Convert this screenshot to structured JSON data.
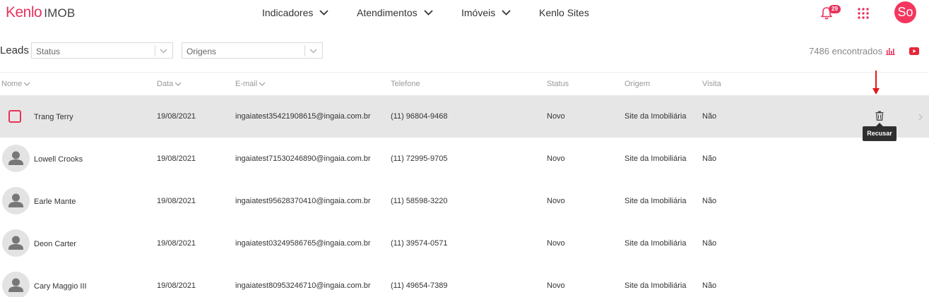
{
  "brand": {
    "logo_main": "Kenlo",
    "logo_sub": "IMOB",
    "accent": "#e8325d"
  },
  "nav": [
    {
      "label": "Indicadores",
      "dropdown": true
    },
    {
      "label": "Atendimentos",
      "dropdown": true
    },
    {
      "label": "Imóveis",
      "dropdown": true
    },
    {
      "label": "Kenlo Sites",
      "dropdown": false
    }
  ],
  "notifications": {
    "count": "29",
    "icon": "bell-icon"
  },
  "user": {
    "initials": "So"
  },
  "page": {
    "title": "Leads"
  },
  "filters": {
    "status": {
      "placeholder": "Status"
    },
    "origens": {
      "placeholder": "Origens"
    }
  },
  "results": {
    "found": "7486 encontrados"
  },
  "table": {
    "columns": [
      "Nome",
      "Data",
      "E-mail",
      "Telefone",
      "Status",
      "Origem",
      "Visita"
    ],
    "rows": [
      {
        "name": "Trang Terry",
        "date": "19/08/2021",
        "email": "ingaiatest35421908615@ingaia.com.br",
        "phone": "(11) 96804-9468",
        "status": "Novo",
        "origin": "Site da Imobiliária",
        "visit": "Não"
      },
      {
        "name": "Lowell Crooks",
        "date": "19/08/2021",
        "email": "ingaiatest71530246890@ingaia.com.br",
        "phone": "(11) 72995-9705",
        "status": "Novo",
        "origin": "Site da Imobiliária",
        "visit": "Não"
      },
      {
        "name": "Earle Mante",
        "date": "19/08/2021",
        "email": "ingaiatest95628370410@ingaia.com.br",
        "phone": "(11) 58598-3220",
        "status": "Novo",
        "origin": "Site da Imobiliária",
        "visit": "Não"
      },
      {
        "name": "Deon Carter",
        "date": "19/08/2021",
        "email": "ingaiatest03249586765@ingaia.com.br",
        "phone": "(11) 39574-0571",
        "status": "Novo",
        "origin": "Site da Imobiliária",
        "visit": "Não"
      },
      {
        "name": "Cary Maggio III",
        "date": "19/08/2021",
        "email": "ingaiatest80953246710@ingaia.com.br",
        "phone": "(11) 49654-7389",
        "status": "Novo",
        "origin": "Site da Imobiliária",
        "visit": "Não"
      }
    ]
  },
  "row_action": {
    "tooltip": "Recusar"
  }
}
